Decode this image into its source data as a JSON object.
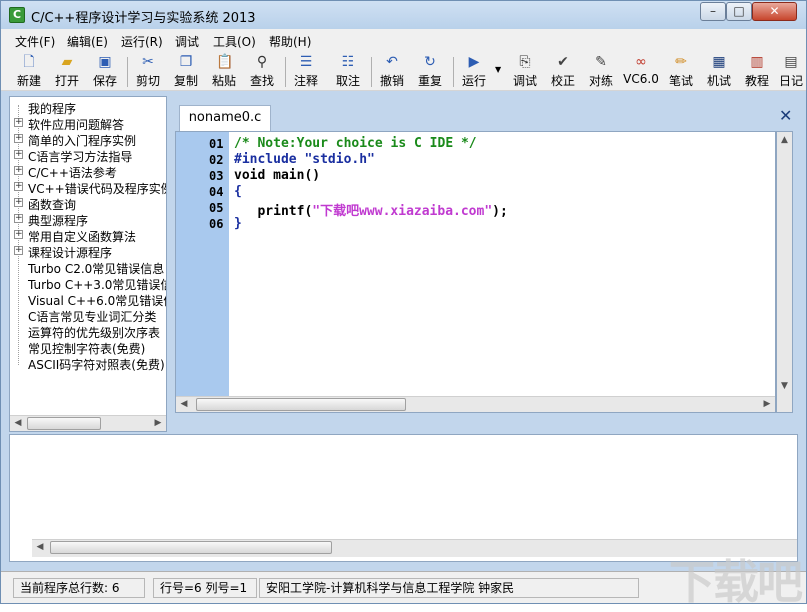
{
  "window": {
    "title": "C/C++程序设计学习与实验系统 2013",
    "app_icon_letter": "C",
    "minimize": "–",
    "maximize": "□",
    "close": "✕"
  },
  "menu": [
    "文件(F)",
    "编辑(E)",
    "运行(R)",
    "调试",
    "工具(O)",
    "帮助(H)"
  ],
  "toolbar": [
    {
      "label": "新建",
      "icon": "new-file-icon"
    },
    {
      "label": "打开",
      "icon": "open-folder-icon"
    },
    {
      "label": "保存",
      "icon": "save-icon"
    },
    {
      "label": "剪切",
      "icon": "cut-icon"
    },
    {
      "label": "复制",
      "icon": "copy-icon"
    },
    {
      "label": "粘贴",
      "icon": "paste-icon"
    },
    {
      "label": "查找",
      "icon": "find-icon"
    },
    {
      "label": "注释",
      "icon": "comment-icon"
    },
    {
      "label": "取注",
      "icon": "uncomment-icon"
    },
    {
      "label": "撤销",
      "icon": "undo-icon"
    },
    {
      "label": "重复",
      "icon": "redo-icon"
    },
    {
      "label": "运行",
      "icon": "run-icon"
    },
    {
      "label": "调试",
      "icon": "debug-icon"
    },
    {
      "label": "校正",
      "icon": "check-icon"
    },
    {
      "label": "对练",
      "icon": "practice-icon"
    },
    {
      "label": "VC6.0",
      "icon": "vc6-icon"
    },
    {
      "label": "笔试",
      "icon": "pen-icon"
    },
    {
      "label": "机试",
      "icon": "computer-test-icon"
    },
    {
      "label": "教程",
      "icon": "books-icon"
    },
    {
      "label": "日记",
      "icon": "diary-icon"
    }
  ],
  "tree": [
    {
      "label": "我的程序",
      "expandable": false
    },
    {
      "label": "软件应用问题解答",
      "expandable": true
    },
    {
      "label": "简单的入门程序实例",
      "expandable": true
    },
    {
      "label": "C语言学习方法指导",
      "expandable": true
    },
    {
      "label": "C/C++语法参考",
      "expandable": true
    },
    {
      "label": "VC++错误代码及程序实例",
      "expandable": true
    },
    {
      "label": "函数查询",
      "expandable": true
    },
    {
      "label": "典型源程序",
      "expandable": true
    },
    {
      "label": "常用自定义函数算法",
      "expandable": true
    },
    {
      "label": "课程设计源程序",
      "expandable": true
    },
    {
      "label": "Turbo C2.0常见错误信息",
      "expandable": false
    },
    {
      "label": "Turbo C++3.0常见错误信息",
      "expandable": false
    },
    {
      "label": "Visual C++6.0常见错误信息",
      "expandable": false
    },
    {
      "label": "C语言常见专业词汇分类",
      "expandable": false
    },
    {
      "label": "运算符的优先级别次序表",
      "expandable": false
    },
    {
      "label": "常见控制字符表(免费)",
      "expandable": false
    },
    {
      "label": "ASCII码字符对照表(免费)",
      "expandable": false
    }
  ],
  "editor": {
    "tab_label": "noname0.c",
    "tab_close": "✕",
    "line_numbers": [
      "01",
      "02",
      "03",
      "04",
      "05",
      "06"
    ],
    "lines": [
      {
        "text": "/* Note:Your choice is C IDE */",
        "kind": "c-comment"
      },
      {
        "text": "#include \"stdio.h\"",
        "kind": "c-pre"
      },
      {
        "text": "void main()",
        "kind": "c-kw"
      },
      {
        "text": "{",
        "kind": "c-brace"
      },
      {
        "text": "   printf(\"下载吧www.xiazaiba.com\");",
        "kind": "c-kw"
      },
      {
        "text": "}",
        "kind": "c-brace"
      }
    ]
  },
  "status": {
    "total_lines": "当前程序总行数:  6",
    "position": "行号=6  列号=1",
    "credit": "安阳工学院-计算机科学与信息工程学院  钟家民"
  },
  "watermark": "下载吧"
}
